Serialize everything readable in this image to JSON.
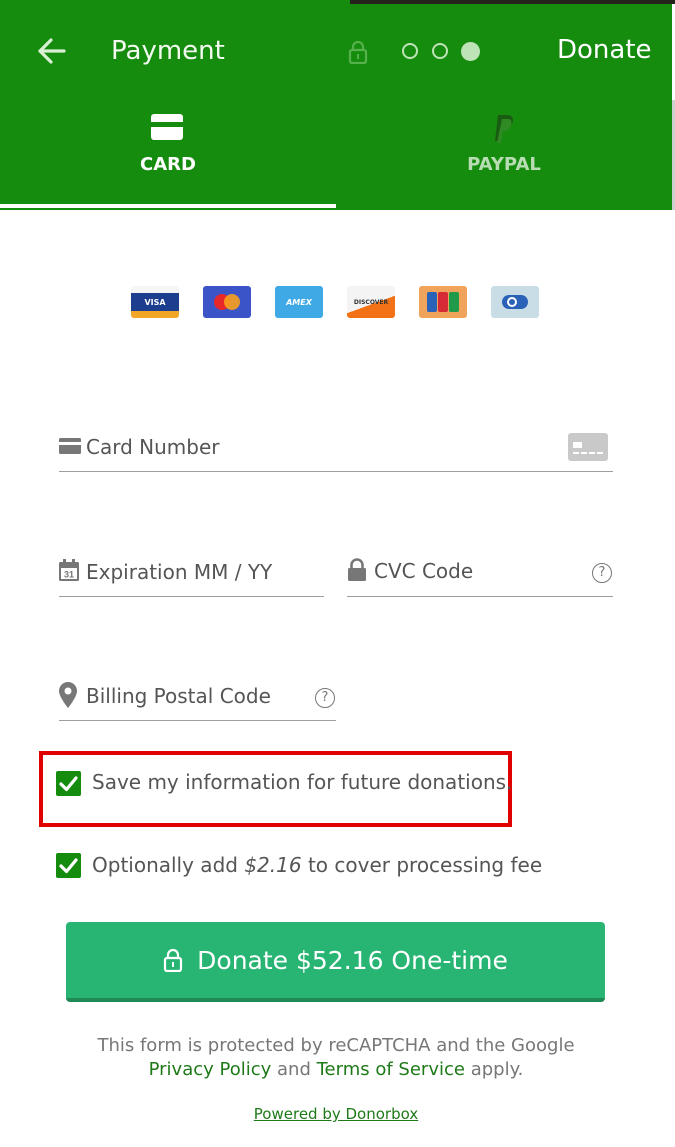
{
  "header": {
    "title": "Payment",
    "donate_label": "Donate"
  },
  "tabs": [
    {
      "label": "CARD",
      "active": true
    },
    {
      "label": "PAYPAL",
      "active": false
    }
  ],
  "card_brands": [
    {
      "name": "visa",
      "text": "VISA"
    },
    {
      "name": "mastercard",
      "text": ""
    },
    {
      "name": "amex",
      "text": "AMEX"
    },
    {
      "name": "discover",
      "text": "DISCOVER"
    },
    {
      "name": "jcb",
      "text": "JCB"
    },
    {
      "name": "diners",
      "text": ""
    }
  ],
  "fields": {
    "card_number": "Card Number",
    "expiration": "Expiration MM / YY",
    "cvc": "CVC Code",
    "postal": "Billing Postal Code",
    "help_symbol": "?"
  },
  "checkboxes": {
    "save_info": "Save my information for future donations.",
    "fee_prefix": "Optionally add",
    "fee_amount": "$2.16",
    "fee_suffix": "to cover processing fee"
  },
  "donate_button": "Donate $52.16 One-time",
  "legal": {
    "line1": "This form is protected by reCAPTCHA and the Google",
    "privacy": "Privacy Policy",
    "and": "and",
    "terms": "Terms of Service",
    "apply": "apply."
  },
  "powered_by": "Powered by Donorbox",
  "colors": {
    "header_green": "#168c0f",
    "button_green": "#28b574",
    "highlight_red": "#e10000"
  }
}
